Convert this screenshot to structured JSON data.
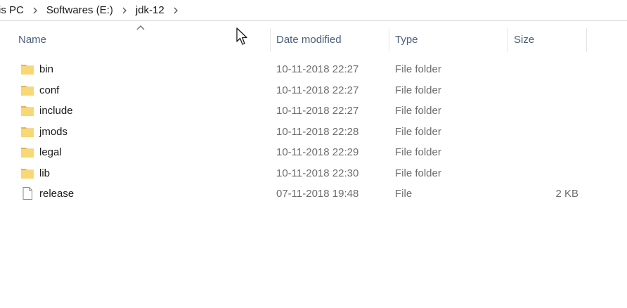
{
  "breadcrumb": [
    {
      "label": "is PC"
    },
    {
      "label": "Softwares (E:)"
    },
    {
      "label": "jdk-12"
    }
  ],
  "columns": {
    "name": "Name",
    "date": "Date modified",
    "type": "Type",
    "size": "Size"
  },
  "sort": {
    "column": "name",
    "direction": "ascending"
  },
  "files": [
    {
      "name": "bin",
      "date": "10-11-2018 22:27",
      "type": "File folder",
      "size": "",
      "icon": "folder-icon"
    },
    {
      "name": "conf",
      "date": "10-11-2018 22:27",
      "type": "File folder",
      "size": "",
      "icon": "folder-icon"
    },
    {
      "name": "include",
      "date": "10-11-2018 22:27",
      "type": "File folder",
      "size": "",
      "icon": "folder-icon"
    },
    {
      "name": "jmods",
      "date": "10-11-2018 22:28",
      "type": "File folder",
      "size": "",
      "icon": "folder-icon"
    },
    {
      "name": "legal",
      "date": "10-11-2018 22:29",
      "type": "File folder",
      "size": "",
      "icon": "folder-icon"
    },
    {
      "name": "lib",
      "date": "10-11-2018 22:30",
      "type": "File folder",
      "size": "",
      "icon": "folder-icon"
    },
    {
      "name": "release",
      "date": "07-11-2018 19:48",
      "type": "File",
      "size": "2 KB",
      "icon": "file-icon"
    }
  ],
  "colors": {
    "folder": "#f8d775",
    "folder_dark": "#e3b74a",
    "header_text": "#4c607a",
    "secondary_text": "#6d6d6d"
  }
}
